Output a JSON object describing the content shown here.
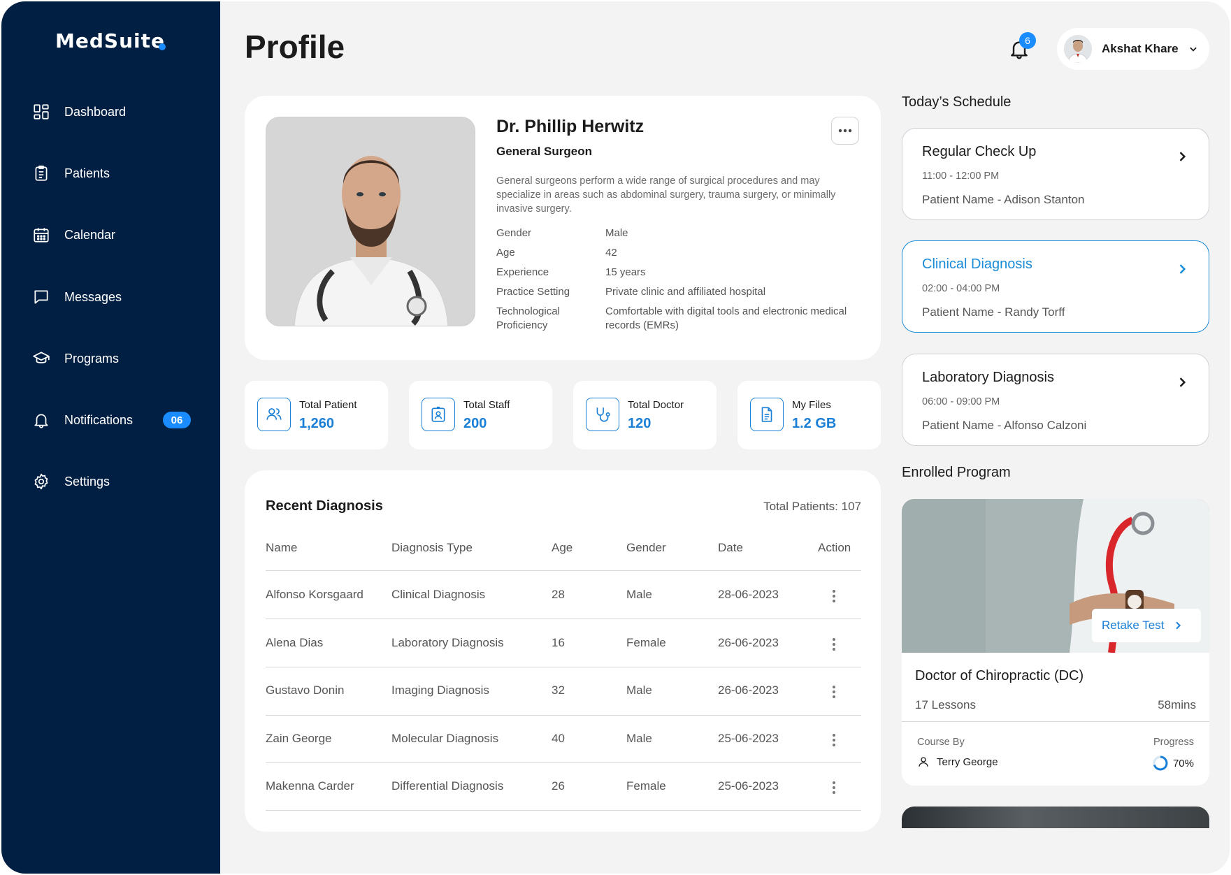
{
  "brand": {
    "name": "MedSuite"
  },
  "sidebar": {
    "items": [
      {
        "label": "Dashboard",
        "icon": "dashboard-icon"
      },
      {
        "label": "Patients",
        "icon": "clipboard-icon"
      },
      {
        "label": "Calendar",
        "icon": "calendar-icon"
      },
      {
        "label": "Messages",
        "icon": "message-icon"
      },
      {
        "label": "Programs",
        "icon": "graduation-cap-icon"
      },
      {
        "label": "Notifications",
        "icon": "bell-icon",
        "badge": "06"
      },
      {
        "label": "Settings",
        "icon": "gear-icon"
      }
    ]
  },
  "header": {
    "title": "Profile",
    "notification_count": "6",
    "user_name": "Akshat Khare"
  },
  "profile": {
    "name": "Dr. Phillip Herwitz",
    "role": "General Surgeon",
    "description": "General surgeons perform a wide range of surgical procedures and may specialize in areas such as abdominal surgery, trauma surgery, or minimally invasive surgery.",
    "details": [
      {
        "key": "Gender",
        "value": "Male"
      },
      {
        "key": "Age",
        "value": "42"
      },
      {
        "key": "Experience",
        "value": "15 years"
      },
      {
        "key": "Practice Setting",
        "value": "Private clinic and affiliated hospital"
      },
      {
        "key": "Technological Proficiency",
        "value": "Comfortable with digital tools and electronic medical records (EMRs)"
      }
    ]
  },
  "stats": [
    {
      "label": "Total Patient",
      "value": "1,260",
      "icon": "users-icon"
    },
    {
      "label": "Total Staff",
      "value": "200",
      "icon": "id-badge-icon"
    },
    {
      "label": "Total Doctor",
      "value": "120",
      "icon": "stethoscope-icon"
    },
    {
      "label": "My Files",
      "value": "1.2 GB",
      "icon": "file-icon"
    }
  ],
  "diagnosis": {
    "title": "Recent Diagnosis",
    "total": "Total Patients: 107",
    "columns": [
      "Name",
      "Diagnosis Type",
      "Age",
      "Gender",
      "Date",
      "Action"
    ],
    "rows": [
      {
        "name": "Alfonso Korsgaard",
        "type": "Clinical Diagnosis",
        "age": "28",
        "gender": "Male",
        "date": "28-06-2023"
      },
      {
        "name": "Alena Dias",
        "type": "Laboratory Diagnosis",
        "age": "16",
        "gender": "Female",
        "date": "26-06-2023"
      },
      {
        "name": "Gustavo Donin",
        "type": "Imaging Diagnosis",
        "age": "32",
        "gender": "Male",
        "date": "26-06-2023"
      },
      {
        "name": "Zain George",
        "type": "Molecular Diagnosis",
        "age": "40",
        "gender": "Male",
        "date": "25-06-2023"
      },
      {
        "name": "Makenna Carder",
        "type": "Differential Diagnosis",
        "age": "26",
        "gender": "Female",
        "date": "25-06-2023"
      }
    ]
  },
  "schedule": {
    "title": "Today’s Schedule",
    "items": [
      {
        "title": "Regular Check Up",
        "time": "11:00 - 12:00 PM",
        "patient": "Patient Name - Adison Stanton"
      },
      {
        "title": "Clinical Diagnosis",
        "time": "02:00 - 04:00 PM",
        "patient": "Patient Name - Randy Torff",
        "active": true
      },
      {
        "title": "Laboratory Diagnosis",
        "time": "06:00 - 09:00 PM",
        "patient": "Patient Name - Alfonso Calzoni"
      }
    ]
  },
  "program": {
    "section_title": "Enrolled Program",
    "retake_label": "Retake Test",
    "title": "Doctor of Chiropractic (DC)",
    "lessons": "17 Lessons",
    "duration": "58mins",
    "course_by_label": "Course By",
    "teacher": "Terry George",
    "progress_label": "Progress",
    "progress_text": "70%",
    "progress": 0.7
  },
  "colors": {
    "sidebar": "#011f42",
    "accent": "#1a8cff",
    "link": "#1a7fd6",
    "background": "#f3f3f3"
  }
}
